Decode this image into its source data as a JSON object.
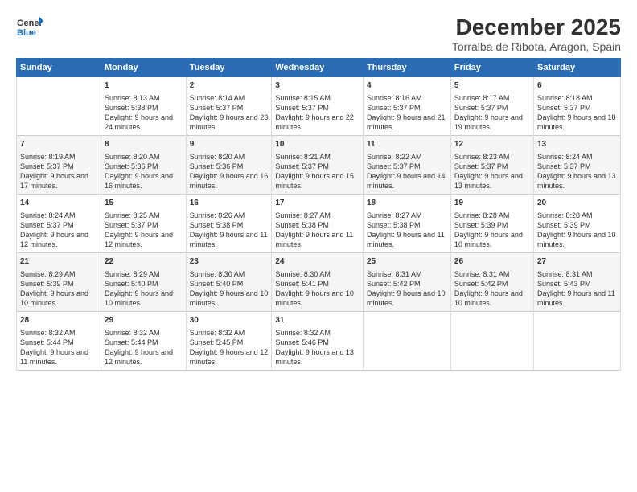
{
  "logo": {
    "line1": "General",
    "line2": "Blue"
  },
  "title": "December 2025",
  "subtitle": "Torralba de Ribota, Aragon, Spain",
  "days_header": [
    "Sunday",
    "Monday",
    "Tuesday",
    "Wednesday",
    "Thursday",
    "Friday",
    "Saturday"
  ],
  "weeks": [
    [
      {
        "num": "",
        "rise": "",
        "set": "",
        "daylight": ""
      },
      {
        "num": "1",
        "rise": "Sunrise: 8:13 AM",
        "set": "Sunset: 5:38 PM",
        "daylight": "Daylight: 9 hours and 24 minutes."
      },
      {
        "num": "2",
        "rise": "Sunrise: 8:14 AM",
        "set": "Sunset: 5:37 PM",
        "daylight": "Daylight: 9 hours and 23 minutes."
      },
      {
        "num": "3",
        "rise": "Sunrise: 8:15 AM",
        "set": "Sunset: 5:37 PM",
        "daylight": "Daylight: 9 hours and 22 minutes."
      },
      {
        "num": "4",
        "rise": "Sunrise: 8:16 AM",
        "set": "Sunset: 5:37 PM",
        "daylight": "Daylight: 9 hours and 21 minutes."
      },
      {
        "num": "5",
        "rise": "Sunrise: 8:17 AM",
        "set": "Sunset: 5:37 PM",
        "daylight": "Daylight: 9 hours and 19 minutes."
      },
      {
        "num": "6",
        "rise": "Sunrise: 8:18 AM",
        "set": "Sunset: 5:37 PM",
        "daylight": "Daylight: 9 hours and 18 minutes."
      }
    ],
    [
      {
        "num": "7",
        "rise": "Sunrise: 8:19 AM",
        "set": "Sunset: 5:37 PM",
        "daylight": "Daylight: 9 hours and 17 minutes."
      },
      {
        "num": "8",
        "rise": "Sunrise: 8:20 AM",
        "set": "Sunset: 5:36 PM",
        "daylight": "Daylight: 9 hours and 16 minutes."
      },
      {
        "num": "9",
        "rise": "Sunrise: 8:20 AM",
        "set": "Sunset: 5:36 PM",
        "daylight": "Daylight: 9 hours and 16 minutes."
      },
      {
        "num": "10",
        "rise": "Sunrise: 8:21 AM",
        "set": "Sunset: 5:37 PM",
        "daylight": "Daylight: 9 hours and 15 minutes."
      },
      {
        "num": "11",
        "rise": "Sunrise: 8:22 AM",
        "set": "Sunset: 5:37 PM",
        "daylight": "Daylight: 9 hours and 14 minutes."
      },
      {
        "num": "12",
        "rise": "Sunrise: 8:23 AM",
        "set": "Sunset: 5:37 PM",
        "daylight": "Daylight: 9 hours and 13 minutes."
      },
      {
        "num": "13",
        "rise": "Sunrise: 8:24 AM",
        "set": "Sunset: 5:37 PM",
        "daylight": "Daylight: 9 hours and 13 minutes."
      }
    ],
    [
      {
        "num": "14",
        "rise": "Sunrise: 8:24 AM",
        "set": "Sunset: 5:37 PM",
        "daylight": "Daylight: 9 hours and 12 minutes."
      },
      {
        "num": "15",
        "rise": "Sunrise: 8:25 AM",
        "set": "Sunset: 5:37 PM",
        "daylight": "Daylight: 9 hours and 12 minutes."
      },
      {
        "num": "16",
        "rise": "Sunrise: 8:26 AM",
        "set": "Sunset: 5:38 PM",
        "daylight": "Daylight: 9 hours and 11 minutes."
      },
      {
        "num": "17",
        "rise": "Sunrise: 8:27 AM",
        "set": "Sunset: 5:38 PM",
        "daylight": "Daylight: 9 hours and 11 minutes."
      },
      {
        "num": "18",
        "rise": "Sunrise: 8:27 AM",
        "set": "Sunset: 5:38 PM",
        "daylight": "Daylight: 9 hours and 11 minutes."
      },
      {
        "num": "19",
        "rise": "Sunrise: 8:28 AM",
        "set": "Sunset: 5:39 PM",
        "daylight": "Daylight: 9 hours and 10 minutes."
      },
      {
        "num": "20",
        "rise": "Sunrise: 8:28 AM",
        "set": "Sunset: 5:39 PM",
        "daylight": "Daylight: 9 hours and 10 minutes."
      }
    ],
    [
      {
        "num": "21",
        "rise": "Sunrise: 8:29 AM",
        "set": "Sunset: 5:39 PM",
        "daylight": "Daylight: 9 hours and 10 minutes."
      },
      {
        "num": "22",
        "rise": "Sunrise: 8:29 AM",
        "set": "Sunset: 5:40 PM",
        "daylight": "Daylight: 9 hours and 10 minutes."
      },
      {
        "num": "23",
        "rise": "Sunrise: 8:30 AM",
        "set": "Sunset: 5:40 PM",
        "daylight": "Daylight: 9 hours and 10 minutes."
      },
      {
        "num": "24",
        "rise": "Sunrise: 8:30 AM",
        "set": "Sunset: 5:41 PM",
        "daylight": "Daylight: 9 hours and 10 minutes."
      },
      {
        "num": "25",
        "rise": "Sunrise: 8:31 AM",
        "set": "Sunset: 5:42 PM",
        "daylight": "Daylight: 9 hours and 10 minutes."
      },
      {
        "num": "26",
        "rise": "Sunrise: 8:31 AM",
        "set": "Sunset: 5:42 PM",
        "daylight": "Daylight: 9 hours and 10 minutes."
      },
      {
        "num": "27",
        "rise": "Sunrise: 8:31 AM",
        "set": "Sunset: 5:43 PM",
        "daylight": "Daylight: 9 hours and 11 minutes."
      }
    ],
    [
      {
        "num": "28",
        "rise": "Sunrise: 8:32 AM",
        "set": "Sunset: 5:44 PM",
        "daylight": "Daylight: 9 hours and 11 minutes."
      },
      {
        "num": "29",
        "rise": "Sunrise: 8:32 AM",
        "set": "Sunset: 5:44 PM",
        "daylight": "Daylight: 9 hours and 12 minutes."
      },
      {
        "num": "30",
        "rise": "Sunrise: 8:32 AM",
        "set": "Sunset: 5:45 PM",
        "daylight": "Daylight: 9 hours and 12 minutes."
      },
      {
        "num": "31",
        "rise": "Sunrise: 8:32 AM",
        "set": "Sunset: 5:46 PM",
        "daylight": "Daylight: 9 hours and 13 minutes."
      },
      {
        "num": "",
        "rise": "",
        "set": "",
        "daylight": ""
      },
      {
        "num": "",
        "rise": "",
        "set": "",
        "daylight": ""
      },
      {
        "num": "",
        "rise": "",
        "set": "",
        "daylight": ""
      }
    ]
  ],
  "colors": {
    "header_bg": "#2a6db5",
    "header_text": "#ffffff",
    "row_even": "#f5f5f5",
    "row_odd": "#ffffff"
  }
}
